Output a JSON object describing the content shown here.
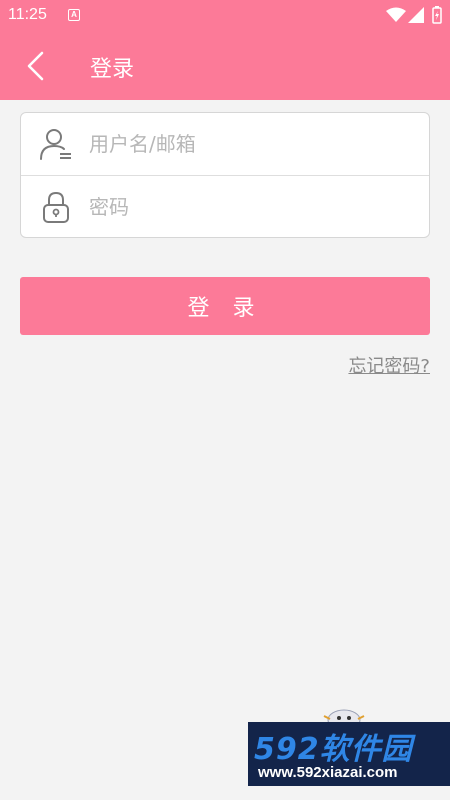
{
  "status_bar": {
    "time": "11:25",
    "notification_glyph": "A"
  },
  "header": {
    "title": "登录"
  },
  "form": {
    "username_placeholder": "用户名/邮箱",
    "password_placeholder": "密码"
  },
  "login_button_label": "登 录",
  "forgot_password_label": "忘记密码?",
  "watermark": {
    "brand": "592软件园",
    "url": "www.592xiazai.com"
  },
  "colors": {
    "accent": "#fc7a98",
    "background": "#f3f3f3"
  }
}
